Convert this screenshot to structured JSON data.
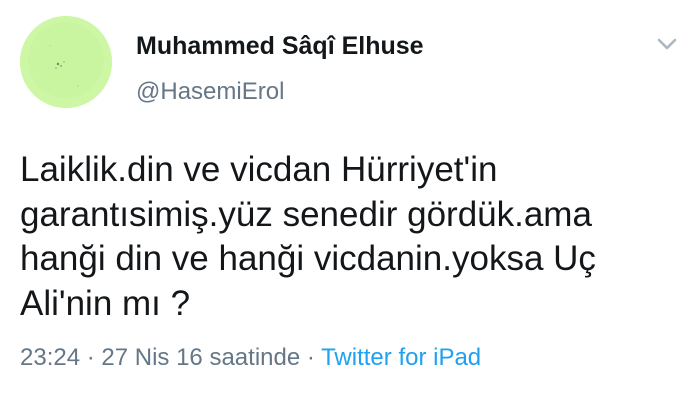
{
  "user": {
    "display_name": "Muhammed Sâqî Elhuse",
    "handle": "@HasemiErol",
    "avatar_color": "#cdf7a5"
  },
  "menu": {
    "icon": "chevron-down-icon"
  },
  "tweet": {
    "text_lines": [
      "Laiklik.din ve vicdan Hürriyet'in",
      "garantısimiş.yüz senedir gördük.ama",
      "hanği din ve hanği vicdanin.yoksa Uç",
      "Ali'nin mı ?"
    ]
  },
  "meta": {
    "time": "23:24",
    "separator": " · ",
    "date": "27 Nis 16 saatinde",
    "source": "Twitter for iPad",
    "source_color": "#1da1f2"
  }
}
